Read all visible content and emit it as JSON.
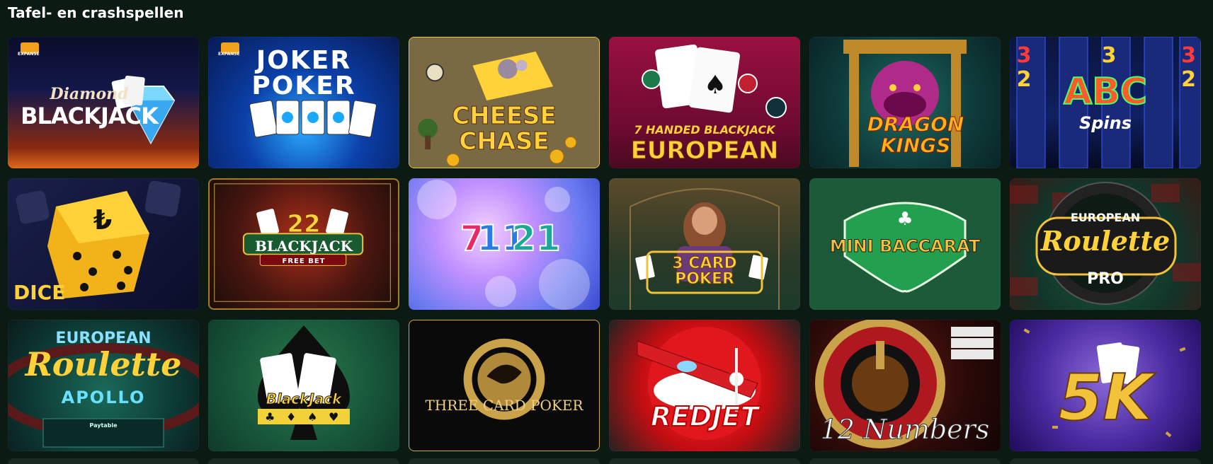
{
  "section": {
    "title": "Tafel- en crashspellen"
  },
  "games": [
    {
      "name": "Diamond Blackjack",
      "line1": "Diamond",
      "line2": "BLACKJACK",
      "badge": "EXPANSE"
    },
    {
      "name": "Joker Poker",
      "line1": "JOKER",
      "line2": "POKER",
      "badge": "EXPANSE"
    },
    {
      "name": "Cheese Chase",
      "line1": "CHEESE",
      "line2": "CHASE"
    },
    {
      "name": "7 Handed Blackjack European",
      "line1": "7 HANDED BLACKJACK",
      "line2": "EUROPEAN"
    },
    {
      "name": "Dragon Kings",
      "line1": "DRAGON",
      "line2": "KINGS"
    },
    {
      "name": "ABC Spins",
      "line1": "ABC",
      "line2": "Spins",
      "reel_numbers": [
        "3",
        "3",
        "3",
        "2",
        "2"
      ]
    },
    {
      "name": "Dice",
      "line1": "DICE"
    },
    {
      "name": "22 Blackjack Free Bet",
      "line1": "22",
      "line2": "BLACKJACK",
      "line3": "FREE BET"
    },
    {
      "name": "7 11 21",
      "line1": "7",
      "line2": "11",
      "line3": "21"
    },
    {
      "name": "3 Card Poker",
      "line1": "3 CARD",
      "line2": "POKER"
    },
    {
      "name": "Mini Baccarat",
      "line1": "MINI BACCARAT"
    },
    {
      "name": "European Roulette Pro",
      "line1": "EUROPEAN",
      "line2": "Roulette",
      "line3": "PRO"
    },
    {
      "name": "European Roulette Apollo",
      "line1": "EUROPEAN",
      "line2": "Roulette",
      "line3": "APOLLO",
      "line4": "Paytable"
    },
    {
      "name": "BlackJack",
      "line1": "BlackJack"
    },
    {
      "name": "Three Card Poker",
      "line1": "THREE CARD POKER"
    },
    {
      "name": "RedJet",
      "line1": "REDJET"
    },
    {
      "name": "12 Numbers",
      "line1": "12 Numbers"
    },
    {
      "name": "5K",
      "line1": "5K"
    }
  ],
  "colors": {
    "page_bg": "#0c1a14",
    "gold": "#f2c23a",
    "red": "#d4141a",
    "green_felt": "#1d5a3a"
  }
}
